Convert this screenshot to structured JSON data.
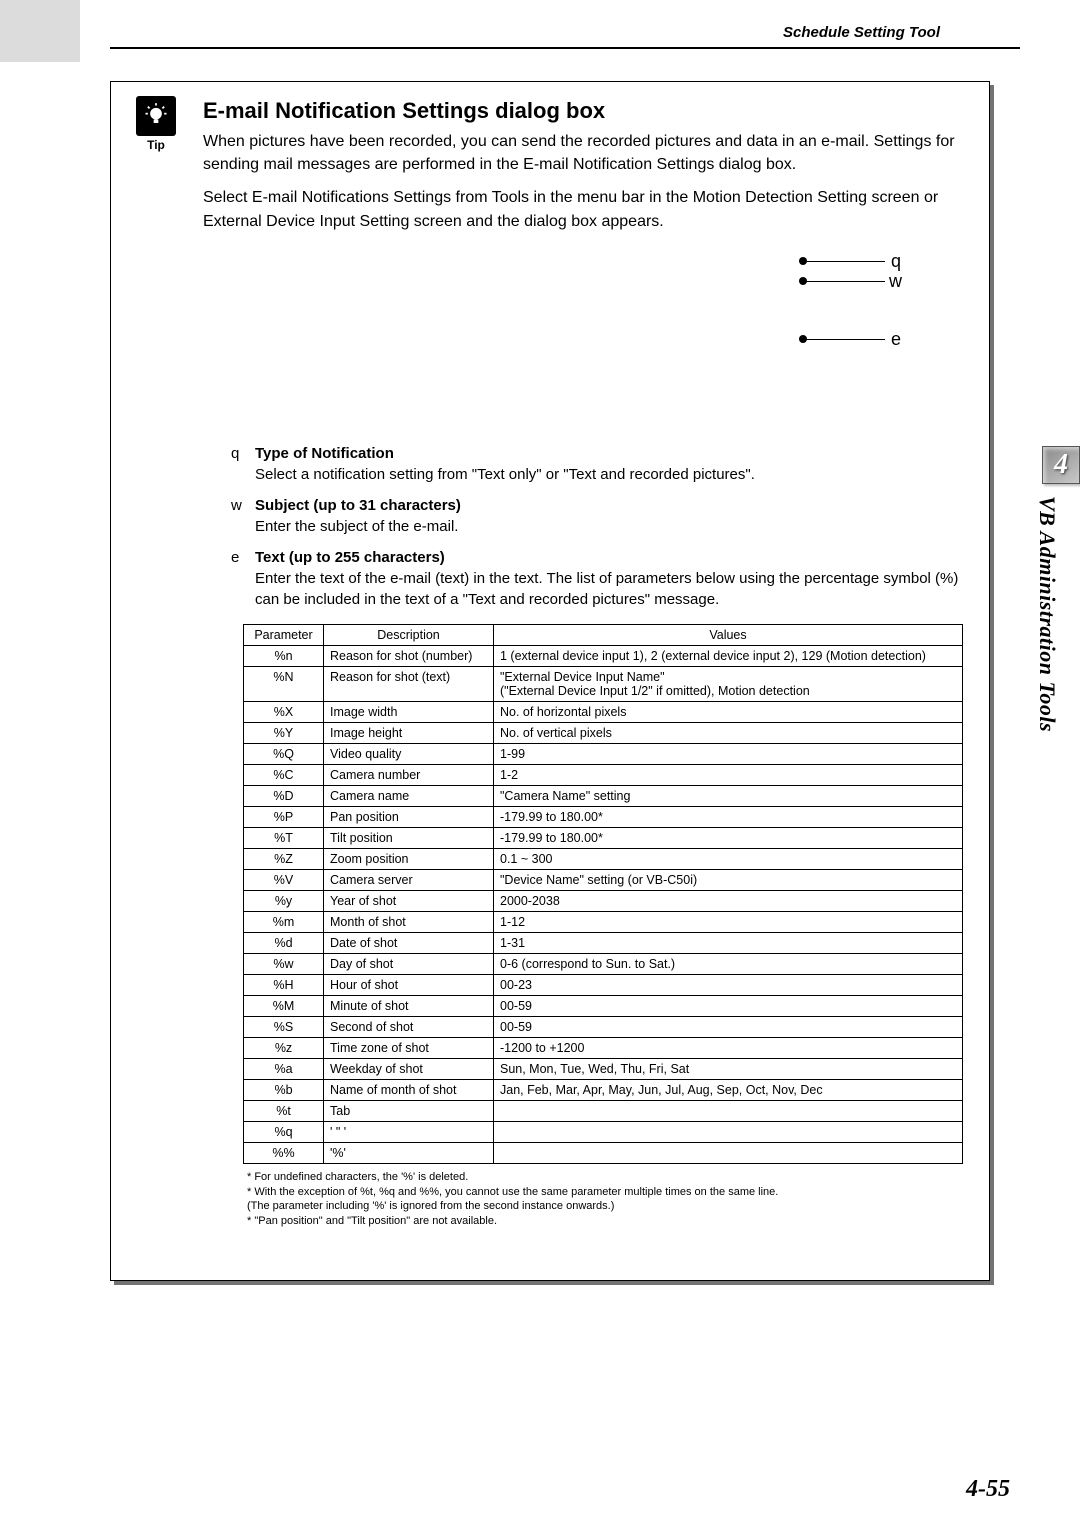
{
  "breadcrumb": "Schedule Setting Tool",
  "tip_label": "Tip",
  "title": "E-mail Notification Settings dialog box",
  "intro_p1": "When pictures have been recorded, you can send the recorded pictures and data in an e-mail. Settings for sending mail messages are performed in the E-mail Notification Settings dialog box.",
  "intro_p2": "Select E-mail Notifications Settings from Tools in the menu bar in the Motion Detection Setting screen or External Device Input Setting screen and the dialog box appears.",
  "annot": {
    "q": "q",
    "w": "w",
    "e": "e"
  },
  "defs": [
    {
      "num": "q",
      "head": "Type of Notification",
      "body": "Select a notification setting from \"Text only\" or \"Text and recorded pictures\"."
    },
    {
      "num": "w",
      "head": "Subject (up to 31 characters)",
      "body": "Enter the subject of the e-mail."
    },
    {
      "num": "e",
      "head": "Text (up to 255 characters)",
      "body": "Enter the text of the e-mail (text) in the text. The list of parameters below using the percentage symbol (%) can be included in the text of a \"Text and recorded pictures\" message."
    }
  ],
  "table": {
    "headers": [
      "Parameter",
      "Description",
      "Values"
    ],
    "rows": [
      [
        "%n",
        "Reason for shot (number)",
        "1 (external device input 1), 2 (external device input 2), 129 (Motion detection)"
      ],
      [
        "%N",
        "Reason for shot (text)",
        "\"External Device Input Name\"\n(\"External Device Input 1/2\" if omitted), Motion detection"
      ],
      [
        "%X",
        "Image width",
        "No. of horizontal pixels"
      ],
      [
        "%Y",
        "Image height",
        "No. of vertical pixels"
      ],
      [
        "%Q",
        "Video quality",
        "1-99"
      ],
      [
        "%C",
        "Camera number",
        "1-2"
      ],
      [
        "%D",
        "Camera name",
        "\"Camera Name\" setting"
      ],
      [
        "%P",
        "Pan position",
        "-179.99 to 180.00*"
      ],
      [
        "%T",
        "Tilt position",
        "-179.99 to 180.00*"
      ],
      [
        "%Z",
        "Zoom position",
        "0.1 ~ 300"
      ],
      [
        "%V",
        "Camera server",
        "\"Device Name\" setting (or VB-C50i)"
      ],
      [
        "%y",
        "Year of shot",
        "2000-2038"
      ],
      [
        "%m",
        "Month of shot",
        "1-12"
      ],
      [
        "%d",
        "Date of shot",
        "1-31"
      ],
      [
        "%w",
        "Day of shot",
        "0-6 (correspond to Sun. to Sat.)"
      ],
      [
        "%H",
        "Hour of shot",
        "00-23"
      ],
      [
        "%M",
        "Minute of shot",
        "00-59"
      ],
      [
        "%S",
        "Second of shot",
        "00-59"
      ],
      [
        "%z",
        "Time zone of shot",
        "-1200 to +1200"
      ],
      [
        "%a",
        "Weekday of shot",
        "Sun, Mon, Tue, Wed, Thu, Fri, Sat"
      ],
      [
        "%b",
        "Name of month of shot",
        "Jan, Feb, Mar, Apr, May, Jun, Jul, Aug, Sep, Oct, Nov, Dec"
      ],
      [
        "%t",
        "Tab",
        ""
      ],
      [
        "%q",
        "' \" '",
        ""
      ],
      [
        "%%",
        "'%'",
        ""
      ]
    ]
  },
  "footnotes": [
    "* For undefined characters, the '%' is deleted.",
    "* With the exception of %t, %q and %%, you cannot use the same parameter multiple times on the same line.",
    "(The parameter including '%' is ignored from the second instance onwards.)",
    "* \"Pan position\" and \"Tilt position\" are not available."
  ],
  "side": {
    "num": "4",
    "label": "VB Administration Tools"
  },
  "page_num": "4-55"
}
